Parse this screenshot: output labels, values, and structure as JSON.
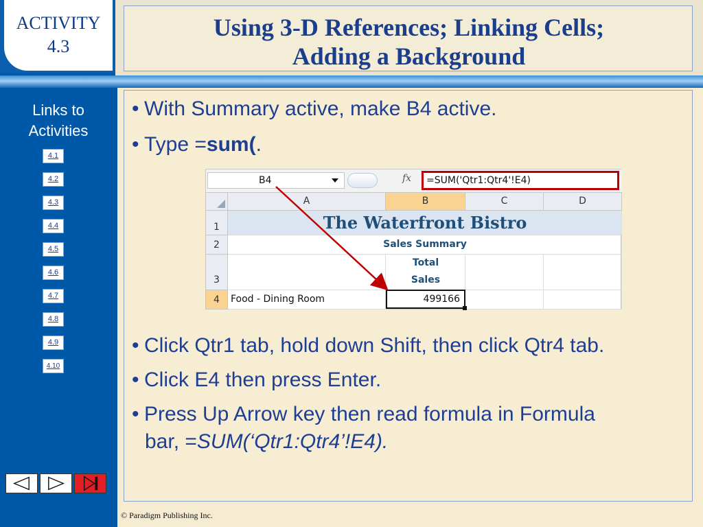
{
  "activity": {
    "label": "ACTIVITY",
    "number": "4.3"
  },
  "slide_title_line1": "Using 3-D References; Linking Cells;",
  "slide_title_line2": "Adding a Background",
  "links": {
    "title_line1": "Links to",
    "title_line2": "Activities",
    "items": [
      "4.1",
      "4.2",
      "4.3",
      "4.4",
      "4.5",
      "4.6",
      "4.7",
      "4.8",
      "4.9",
      "4.10"
    ]
  },
  "bullets": {
    "b1": "With Summary active, make B4 active.",
    "b2_pre": "Type =",
    "b2_bold": "sum(",
    "b2_post": ".",
    "b3": "Click Qtr1 tab, hold down Shift, then click Qtr4 tab.",
    "b4": "Click E4 then press Enter.",
    "b5_line1": "Press Up Arrow key then read formula in Formula",
    "b5_line2_pre": "bar, =",
    "b5_line2_italic": "SUM(‘Qtr1:Qtr4’!E4)."
  },
  "excel": {
    "name_box": "B4",
    "fx_symbol": "fx",
    "formula": "=SUM('Qtr1:Qtr4'!E4)",
    "columns": [
      "A",
      "B",
      "C",
      "D"
    ],
    "rows": [
      "1",
      "2",
      "3",
      "4"
    ],
    "title_cell": "The Waterfront Bistro",
    "subtitle_cell": "Sales Summary",
    "total_line1": "Total",
    "total_line2": "Sales",
    "food_cell": "Food - Dining Room",
    "active_value": "499166"
  },
  "footer": "© Paradigm Publishing Inc.",
  "colors": {
    "accent_red": "#c00000",
    "rail_blue": "#0059a8",
    "text_blue": "#1d3e92"
  }
}
